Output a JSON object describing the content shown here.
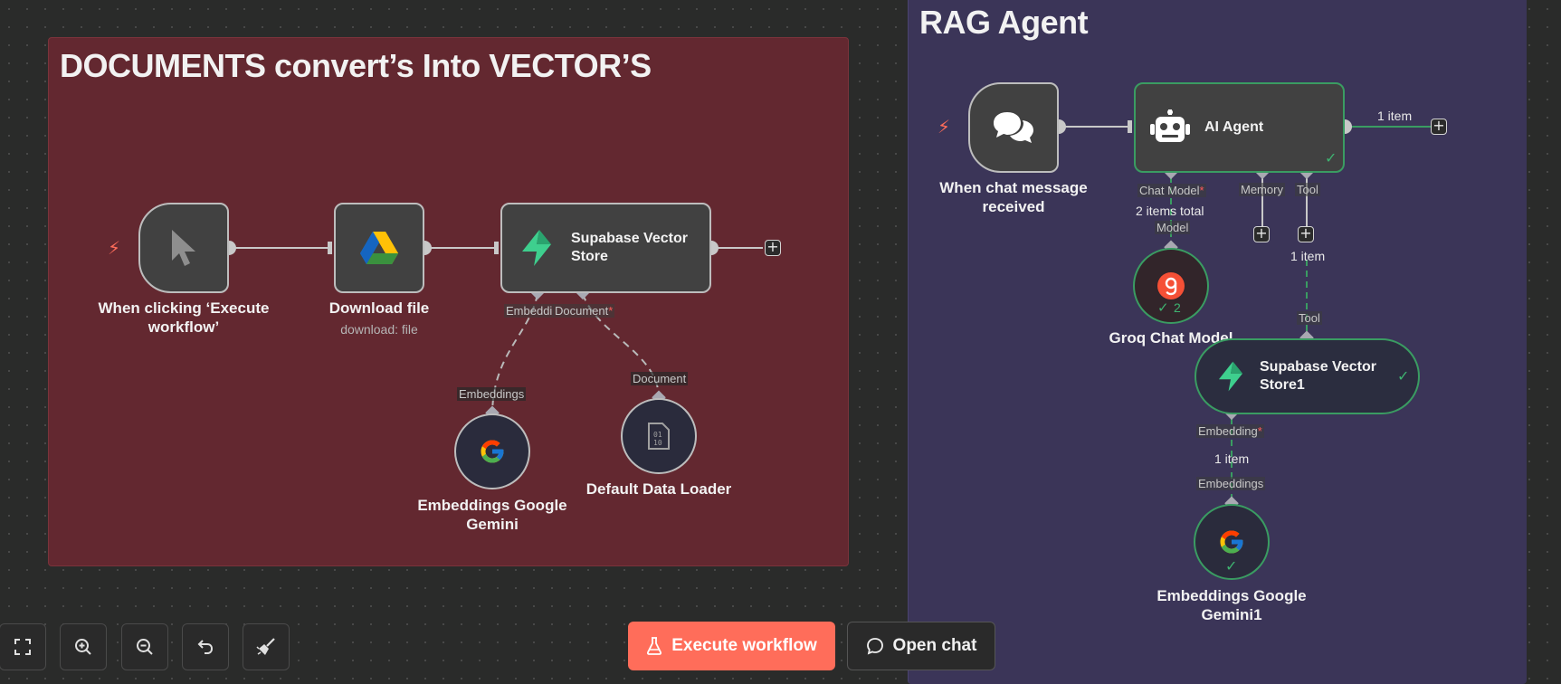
{
  "canvas": {
    "sticky_docs_title": "DOCUMENTS convert’s Into VECTOR’S",
    "sticky_rag_title": "RAG Agent"
  },
  "nodes": {
    "manual_trigger": {
      "label": "When clicking ‘Execute workflow’",
      "icon": "cursor-icon"
    },
    "download_file": {
      "label": "Download file",
      "subtitle": "download: file",
      "icon": "google-drive-icon"
    },
    "supabase_store": {
      "title": "Supabase Vector Store",
      "icon": "supabase-icon"
    },
    "embeddings_gemini": {
      "label": "Embeddings Google Gemini",
      "icon": "google-icon"
    },
    "data_loader": {
      "label": "Default Data Loader",
      "icon": "binary-file-icon"
    },
    "chat_trigger": {
      "label": "When chat message received",
      "icon": "chat-bubbles-icon"
    },
    "ai_agent": {
      "title": "AI Agent",
      "icon": "robot-icon"
    },
    "groq_model": {
      "label": "Groq Chat Model",
      "badge": "2",
      "icon": "groq-icon"
    },
    "supabase_store1": {
      "title": "Supabase Vector Store1",
      "icon": "supabase-icon"
    },
    "embeddings_gemini1": {
      "label": "Embeddings Google Gemini1",
      "icon": "google-icon"
    }
  },
  "ports": {
    "embeddings_short": "Embeddi",
    "document": "Document",
    "embeddings": "Embeddings",
    "document_in": "Document",
    "chat_model": "Chat Model",
    "memory": "Memory",
    "tool": "Tool",
    "model": "Model",
    "tool_in": "Tool",
    "embedding": "Embedding",
    "embeddings_in": "Embeddings",
    "required_mark": "*"
  },
  "counts": {
    "agent_out": "1 item",
    "chat_model_total": "2 items total",
    "tool_items": "1 item",
    "embedding_items": "1 item"
  },
  "toolbar": {
    "execute_label": "Execute workflow",
    "open_chat_label": "Open chat",
    "icons": [
      "fit-view-icon",
      "zoom-in-icon",
      "zoom-out-icon",
      "undo-icon",
      "tidy-up-icon"
    ]
  },
  "colors": {
    "accent": "#ff6d5a",
    "success": "#3a9c62",
    "sticky_red": "#632830",
    "sticky_purple": "#3b3558"
  }
}
